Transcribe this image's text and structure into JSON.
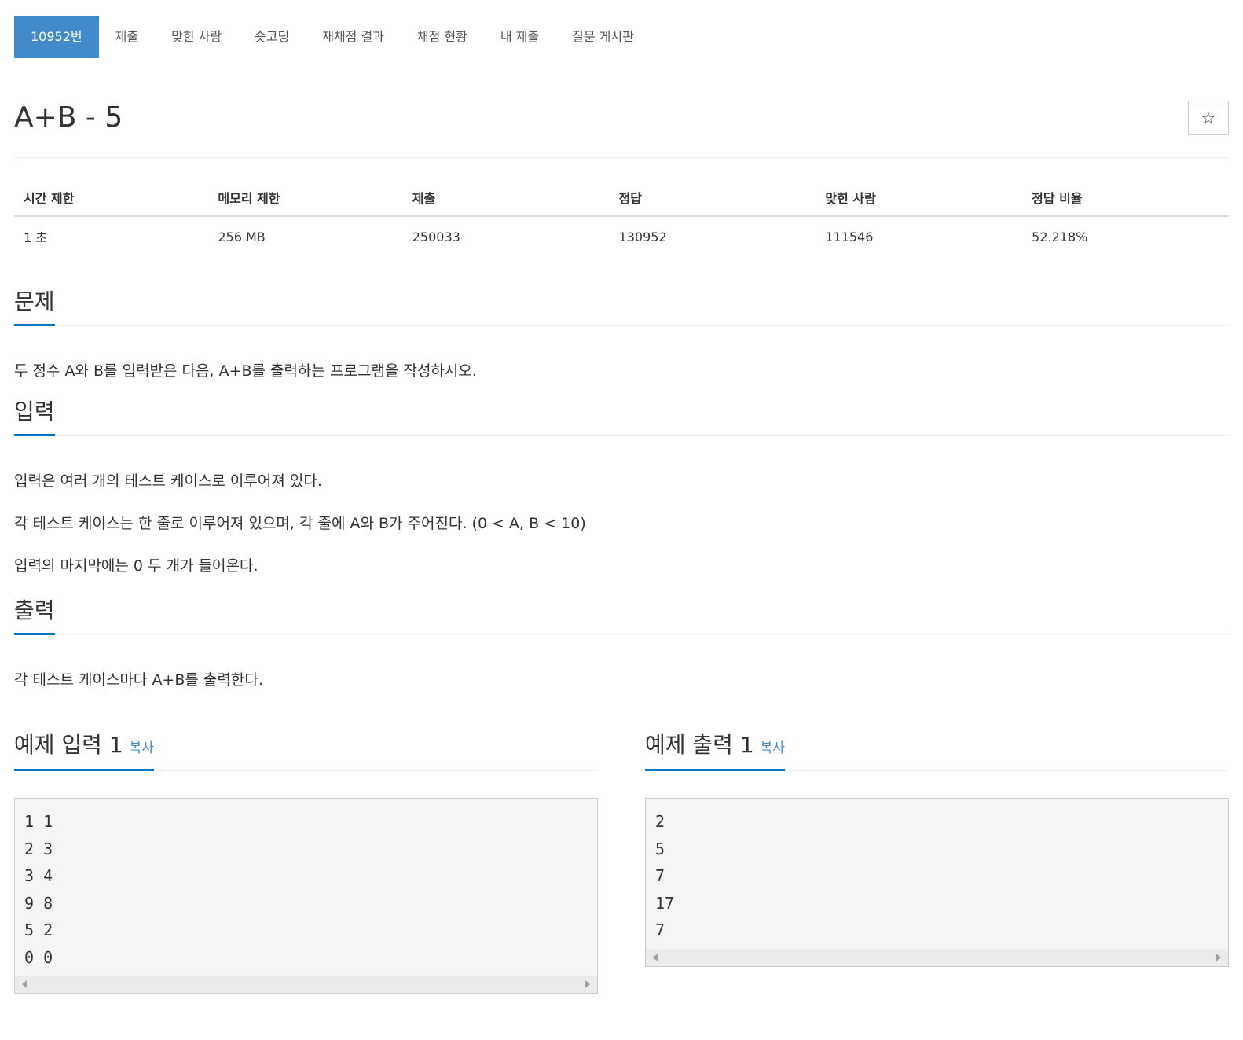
{
  "nav": {
    "items": [
      {
        "label": "10952번",
        "active": true
      },
      {
        "label": "제출"
      },
      {
        "label": "맞힌 사람"
      },
      {
        "label": "숏코딩"
      },
      {
        "label": "재채점 결과"
      },
      {
        "label": "채점 현황"
      },
      {
        "label": "내 제출"
      },
      {
        "label": "질문 게시판"
      }
    ]
  },
  "problem": {
    "title": "A+B - 5",
    "star_icon": "☆"
  },
  "info": {
    "headers": [
      "시간 제한",
      "메모리 제한",
      "제출",
      "정답",
      "맞힌 사람",
      "정답 비율"
    ],
    "values": [
      "1 초",
      "256 MB",
      "250033",
      "130952",
      "111546",
      "52.218%"
    ]
  },
  "sections": {
    "problem": {
      "heading": "문제",
      "paragraphs": [
        "두 정수 A와 B를 입력받은 다음, A+B를 출력하는 프로그램을 작성하시오."
      ]
    },
    "input": {
      "heading": "입력",
      "paragraphs": [
        "입력은 여러 개의 테스트 케이스로 이루어져 있다.",
        "각 테스트 케이스는 한 줄로 이루어져 있으며, 각 줄에 A와 B가 주어진다. (0 < A, B < 10)",
        "입력의 마지막에는 0 두 개가 들어온다."
      ]
    },
    "output": {
      "heading": "출력",
      "paragraphs": [
        "각 테스트 케이스마다 A+B를 출력한다."
      ]
    }
  },
  "samples": {
    "input": {
      "heading": "예제 입력 1",
      "copy_label": "복사",
      "content": "1 1\n2 3\n3 4\n9 8\n5 2\n0 0"
    },
    "output": {
      "heading": "예제 출력 1",
      "copy_label": "복사",
      "content": "2\n5\n7\n17\n7"
    }
  }
}
